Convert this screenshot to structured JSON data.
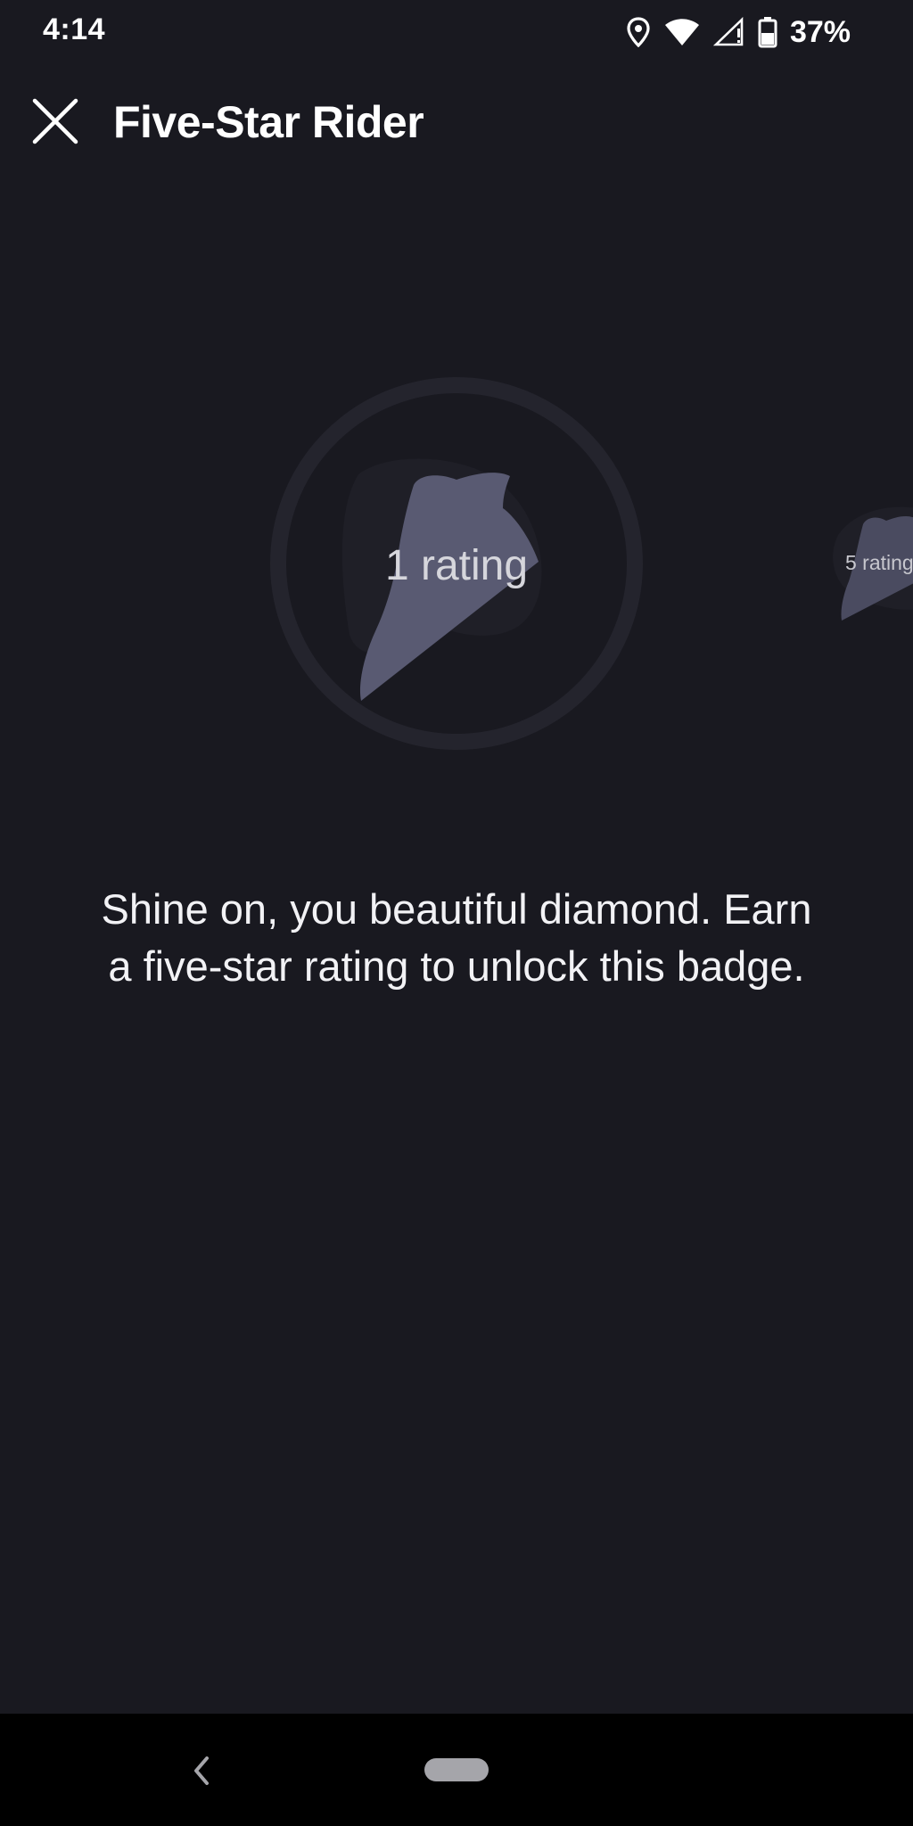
{
  "status_bar": {
    "time": "4:14",
    "battery": "37%",
    "icons": [
      "location-icon",
      "wifi-icon",
      "cell-signal-icon",
      "battery-icon"
    ]
  },
  "header": {
    "title": "Five-Star Rider",
    "close_icon": "close-icon"
  },
  "badges": {
    "current": {
      "label": "1 rating"
    },
    "next": {
      "label": "5 rating"
    }
  },
  "description": {
    "line1": "Shine on, you beautiful diamond. Earn",
    "line2": "a five-star rating to unlock this badge."
  },
  "nav_bar": {
    "back_icon": "back-chevron-icon",
    "home_icon": "home-pill-icon"
  },
  "colors": {
    "background": "#191920",
    "badge_ring": "#26262f",
    "badge_shape": "#595a72",
    "nav_background": "#000000"
  }
}
